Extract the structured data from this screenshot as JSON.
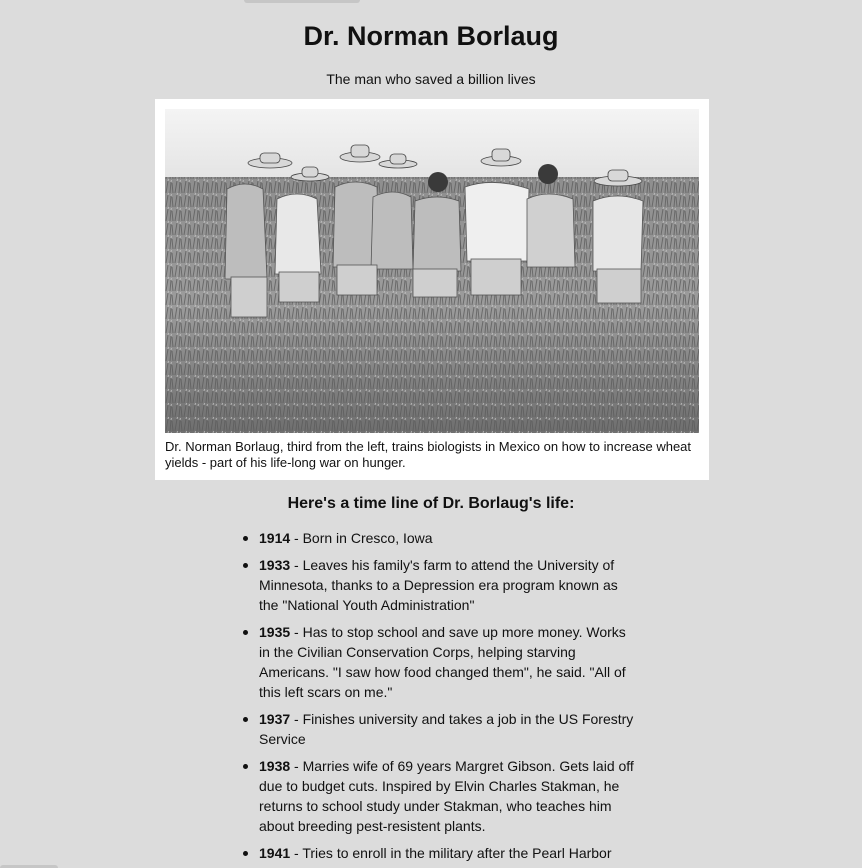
{
  "header": {
    "title": "Dr. Norman Borlaug",
    "subtitle": "The man who saved a billion lives"
  },
  "figure": {
    "caption": "Dr. Norman Borlaug, third from the left, trains biologists in Mexico on how to increase wheat yields - part of his life-long war on hunger."
  },
  "timeline": {
    "heading": "Here's a time line of Dr. Borlaug's life:",
    "items": [
      {
        "year": "1914",
        "text": " - Born in Cresco, Iowa"
      },
      {
        "year": "1933",
        "text": " - Leaves his family's farm to attend the University of Minnesota, thanks to a Depression era program known as the \"National Youth Administration\""
      },
      {
        "year": "1935",
        "text": " - Has to stop school and save up more money. Works in the Civilian Conservation Corps, helping starving Americans. \"I saw how food changed them\", he said. \"All of this left scars on me.\""
      },
      {
        "year": "1937",
        "text": " - Finishes university and takes a job in the US Forestry Service"
      },
      {
        "year": "1938",
        "text": " - Marries wife of 69 years Margret Gibson. Gets laid off due to budget cuts. Inspired by Elvin Charles Stakman, he returns to school study under Stakman, who teaches him about breeding pest-resistent plants."
      },
      {
        "year": "1941",
        "text": " - Tries to enroll in the military after the Pearl Harbor"
      }
    ]
  },
  "colors": {
    "background": "#dcdcdc",
    "card": "#ffffff",
    "text": "#111111"
  }
}
